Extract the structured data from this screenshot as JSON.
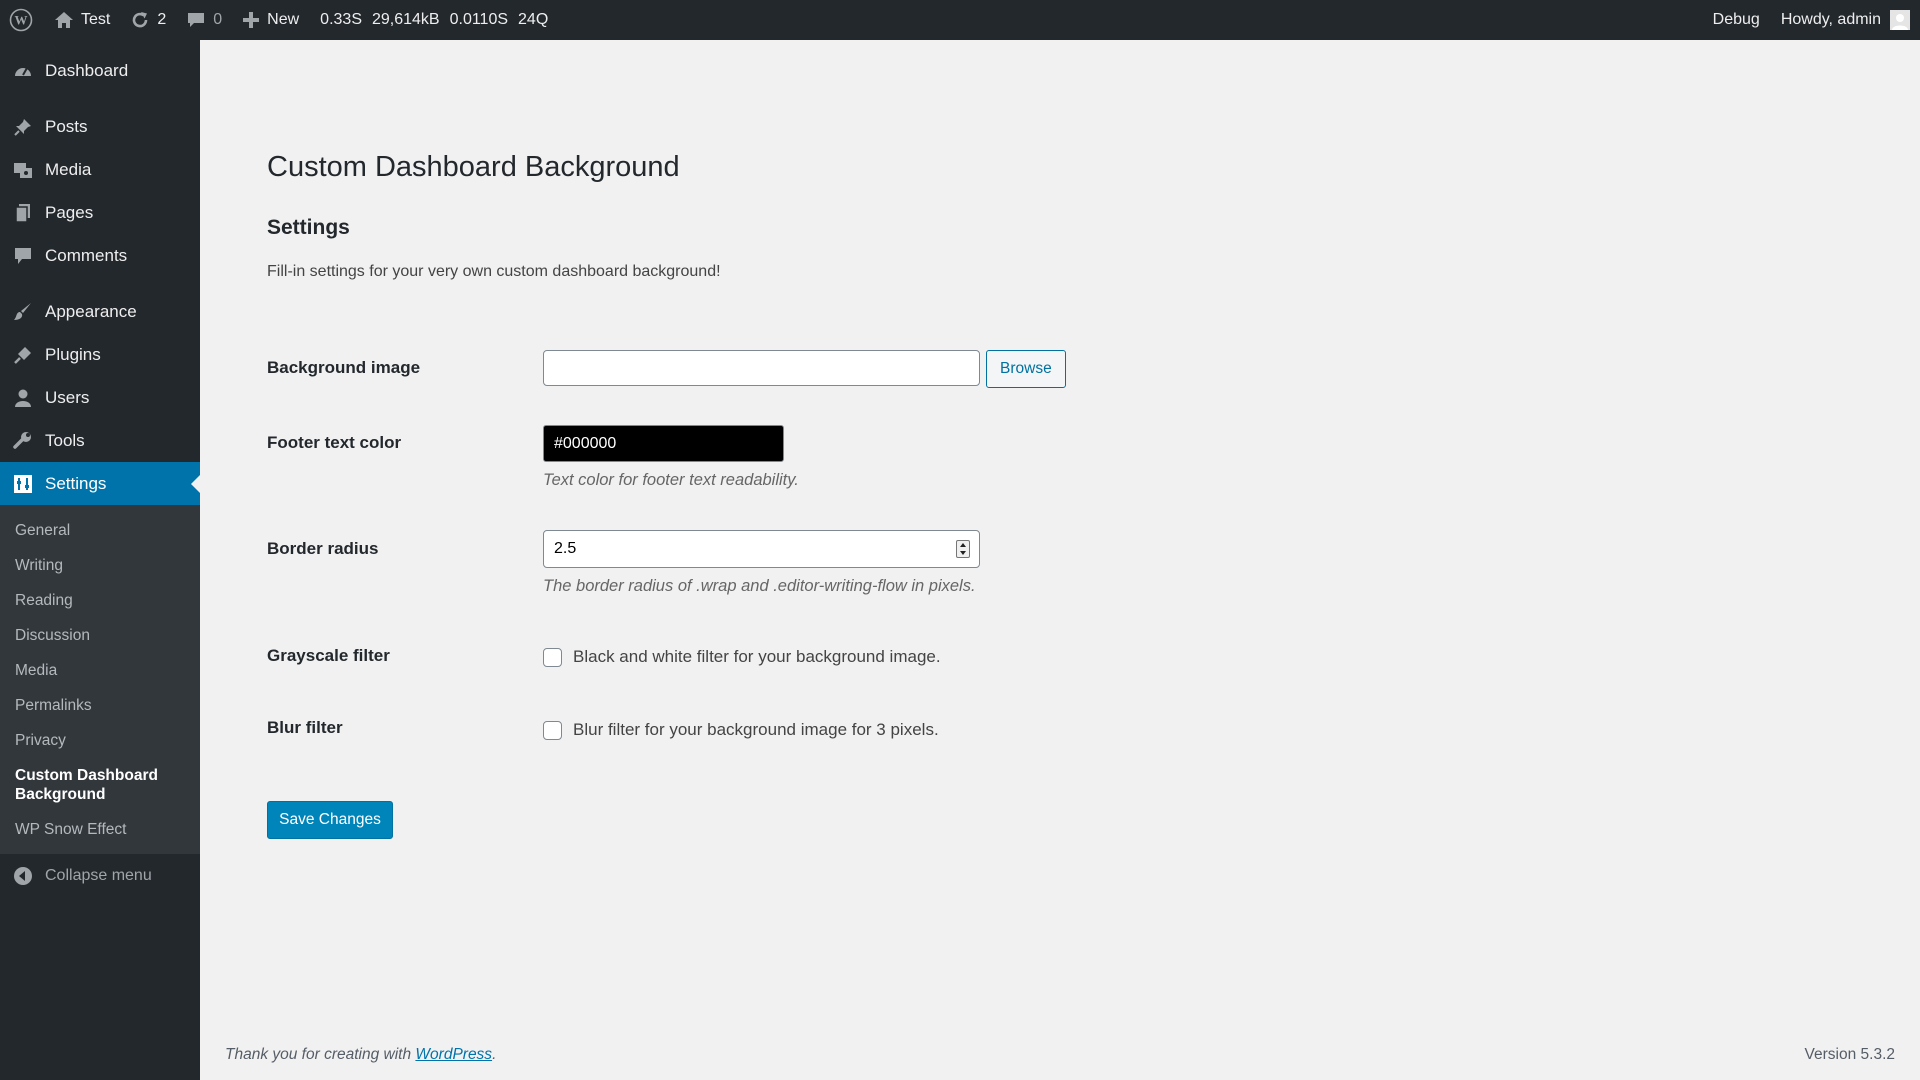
{
  "admin_bar": {
    "site_name": "Test",
    "updates_count": "2",
    "comments_count": "0",
    "new_label": "New",
    "stats": [
      "0.33S",
      "29,614kB",
      "0.0110S",
      "24Q"
    ],
    "debug_label": "Debug",
    "greeting": "Howdy, admin"
  },
  "sidebar": {
    "items": [
      {
        "label": "Dashboard",
        "icon": "dashboard-icon"
      },
      {
        "label": "Posts",
        "icon": "pin-icon"
      },
      {
        "label": "Media",
        "icon": "media-icon"
      },
      {
        "label": "Pages",
        "icon": "pages-icon"
      },
      {
        "label": "Comments",
        "icon": "comment-icon"
      },
      {
        "label": "Appearance",
        "icon": "brush-icon"
      },
      {
        "label": "Plugins",
        "icon": "plugin-icon"
      },
      {
        "label": "Users",
        "icon": "user-icon"
      },
      {
        "label": "Tools",
        "icon": "wrench-icon"
      },
      {
        "label": "Settings",
        "icon": "settings-icon"
      }
    ],
    "submenu": [
      "General",
      "Writing",
      "Reading",
      "Discussion",
      "Media",
      "Permalinks",
      "Privacy",
      "Custom Dashboard Background",
      "WP Snow Effect"
    ],
    "collapse_label": "Collapse menu"
  },
  "page": {
    "title": "Custom Dashboard Background",
    "section_title": "Settings",
    "intro": "Fill-in settings for your very own custom dashboard background!",
    "background_image": {
      "label": "Background image",
      "value": "",
      "button": "Browse"
    },
    "footer_color": {
      "label": "Footer text color",
      "value": "#000000",
      "description": "Text color for footer text readability."
    },
    "border_radius": {
      "label": "Border radius",
      "value": "2.5",
      "description": "The border radius of .wrap and .editor-writing-flow in pixels."
    },
    "grayscale": {
      "label": "Grayscale filter",
      "checkbox_label": "Black and white filter for your background image.",
      "checked": false
    },
    "blur": {
      "label": "Blur filter",
      "checkbox_label": "Blur filter for your background image for 3 pixels.",
      "checked": false
    },
    "save_button": "Save Changes"
  },
  "footer": {
    "thanks_prefix": "Thank you for creating with ",
    "link_text": "WordPress",
    "thanks_suffix": ".",
    "version": "Version 5.3.2"
  },
  "colors": {
    "admin_bar_bg": "#23282d",
    "accent": "#0073aa",
    "primary_button": "#0085ba",
    "page_bg": "#f1f1f1"
  }
}
